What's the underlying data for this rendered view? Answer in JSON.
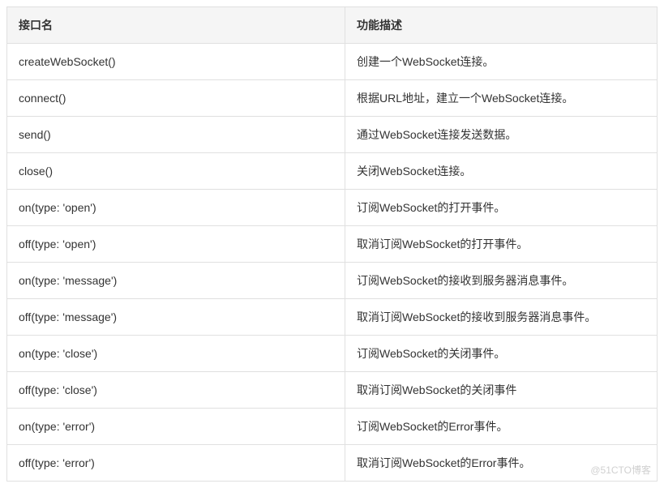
{
  "table": {
    "headers": {
      "name": "接口名",
      "desc": "功能描述"
    },
    "rows": [
      {
        "name": "createWebSocket()",
        "desc": "创建一个WebSocket连接。"
      },
      {
        "name": "connect()",
        "desc": "根据URL地址，建立一个WebSocket连接。"
      },
      {
        "name": "send()",
        "desc": "通过WebSocket连接发送数据。"
      },
      {
        "name": "close()",
        "desc": "关闭WebSocket连接。"
      },
      {
        "name": "on(type: 'open')",
        "desc": "订阅WebSocket的打开事件。"
      },
      {
        "name": "off(type: 'open')",
        "desc": "取消订阅WebSocket的打开事件。"
      },
      {
        "name": "on(type: 'message')",
        "desc": "订阅WebSocket的接收到服务器消息事件。"
      },
      {
        "name": "off(type: 'message')",
        "desc": "取消订阅WebSocket的接收到服务器消息事件。"
      },
      {
        "name": "on(type: 'close')",
        "desc": "订阅WebSocket的关闭事件。"
      },
      {
        "name": "off(type: 'close')",
        "desc": "取消订阅WebSocket的关闭事件"
      },
      {
        "name": "on(type: 'error')",
        "desc": "订阅WebSocket的Error事件。"
      },
      {
        "name": "off(type: 'error')",
        "desc": "取消订阅WebSocket的Error事件。"
      }
    ]
  },
  "watermark": "@51CTO博客"
}
